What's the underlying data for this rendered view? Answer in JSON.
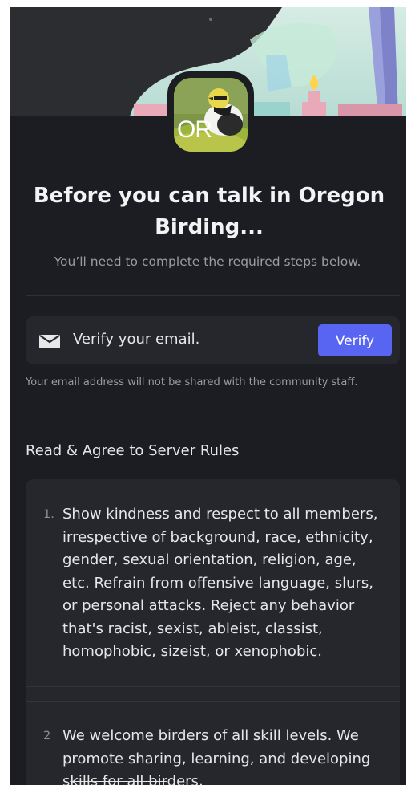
{
  "server": {
    "avatar_initials": "OR"
  },
  "header": {
    "title": "Before you can talk in Oregon Birding...",
    "subtitle": "You’ll need to complete the required steps below."
  },
  "verify_step": {
    "icon": "mail-icon",
    "label": "Verify your email.",
    "button_label": "Verify",
    "note": "Your email address will not be shared with the community staff.",
    "button_color": "#5865f2"
  },
  "rules": {
    "heading": "Read & Agree to Server Rules",
    "items": [
      {
        "number": "1.",
        "text": "Show kindness and respect to all members, irrespective of background, race, ethnicity, gender, sexual orientation, religion, age, etc. Refrain from offensive language, slurs, or personal attacks. Reject any behavior that's racist, sexist, ableist, classist, homophobic, sizeist, or xenophobic."
      },
      {
        "number": "2",
        "text_a": "We welcome birders of all skill levels. We promote sharing, learning, and developing s",
        "text_strike": "kills for all bir",
        "text_b": "ders,"
      }
    ]
  }
}
